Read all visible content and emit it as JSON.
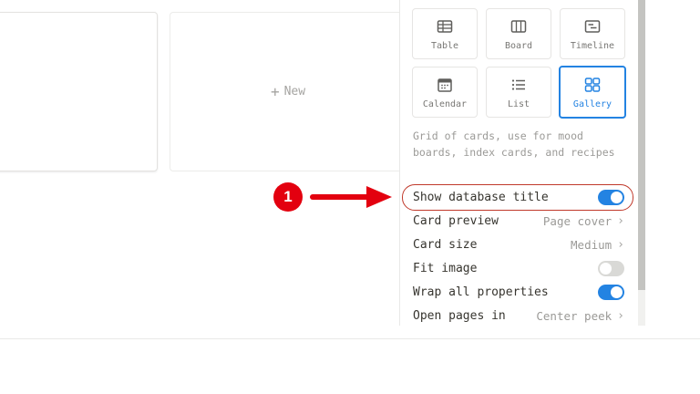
{
  "board": {
    "new_card_label": "New",
    "new_card_plus": "+"
  },
  "layouts": [
    {
      "label": "Table",
      "icon": "table-icon",
      "selected": false
    },
    {
      "label": "Board",
      "icon": "board-icon",
      "selected": false
    },
    {
      "label": "Timeline",
      "icon": "timeline-icon",
      "selected": false
    },
    {
      "label": "Calendar",
      "icon": "calendar-icon",
      "selected": false
    },
    {
      "label": "List",
      "icon": "list-icon",
      "selected": false
    },
    {
      "label": "Gallery",
      "icon": "gallery-icon",
      "selected": true
    }
  ],
  "layout_description": "Grid of cards, use for mood boards, index cards, and recipes",
  "settings": {
    "show_title": {
      "label": "Show database title",
      "on": true
    },
    "card_preview": {
      "label": "Card preview",
      "value": "Page cover"
    },
    "card_size": {
      "label": "Card size",
      "value": "Medium"
    },
    "fit_image": {
      "label": "Fit image",
      "on": false
    },
    "wrap_properties": {
      "label": "Wrap all properties",
      "on": true
    },
    "open_pages_in": {
      "label": "Open pages in",
      "value": "Center peek"
    }
  },
  "annotation": {
    "step_number": "1",
    "color": "#e3000f"
  },
  "colors": {
    "accent": "#2383e2",
    "highlight_border": "#c0392b"
  }
}
